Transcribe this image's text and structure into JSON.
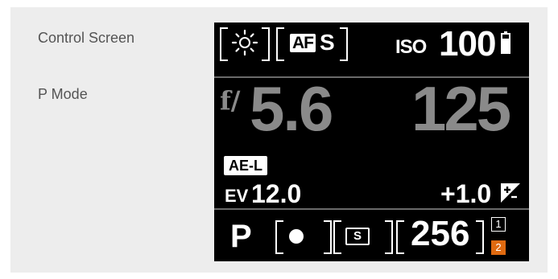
{
  "sidebar": {
    "title": "Control Screen",
    "mode_title": "P Mode"
  },
  "screen": {
    "top": {
      "white_balance_icon": "sun-icon",
      "af_badge": "AF",
      "af_mode": "S",
      "iso_label": "ISO",
      "iso_value": "100",
      "battery_icon": "battery-icon"
    },
    "exposure": {
      "f_label": "f/",
      "aperture": "5.6",
      "shutter": "125"
    },
    "status": {
      "ae_lock": "AE-L",
      "ev_label": "EV",
      "ev_value": "12.0",
      "exposure_comp": "+1.0",
      "comp_icon": "exposure-compensation-icon"
    },
    "bottom": {
      "mode": "P",
      "metering_icon": "metering-icon",
      "drive": "S",
      "shots_remaining": "256",
      "card_slot_1": "1",
      "card_slot_2": "2"
    }
  },
  "colors": {
    "screen_bg": "#000000",
    "dim_value": "#8a8a8a",
    "accent_orange": "#e06a10",
    "panel_bg": "#ededed"
  }
}
